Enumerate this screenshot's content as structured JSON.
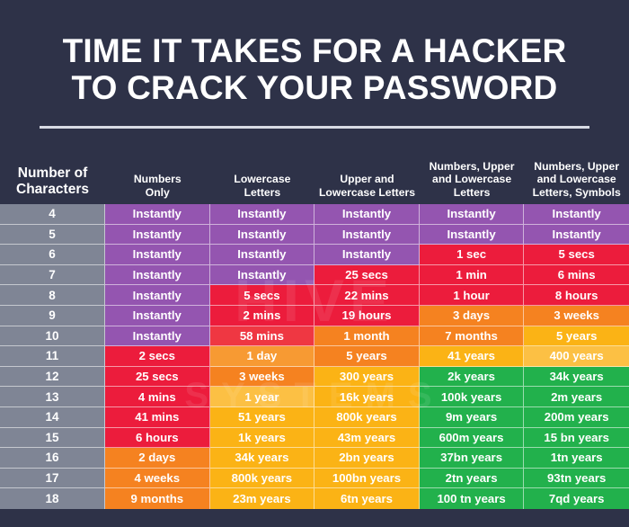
{
  "title": {
    "line1": "TIME IT TAKES FOR A HACKER",
    "line2": "TO CRACK YOUR PASSWORD"
  },
  "watermark": {
    "top": "HIVE",
    "bottom": "SYSTEMS"
  },
  "theme": {
    "background": "#2e3248",
    "divider": "#d8dbe4",
    "label_column": "#7f8595",
    "purple": "#9455b0",
    "red": "#ec1c3c",
    "red_light": "#ef3742",
    "orange": "#f58220",
    "orange_light": "#f79a33",
    "amber": "#fbb315",
    "amber_light": "#fcc044",
    "green": "#22b14c"
  },
  "table": {
    "headers": [
      "Number of Characters",
      "Numbers Only",
      "Lowercase Letters",
      "Upper and Lowercase Letters",
      "Numbers, Upper and Lowercase Letters",
      "Numbers, Upper and Lowercase Letters, Symbols"
    ],
    "header_lines": [
      [
        "Number of",
        "Characters"
      ],
      [
        "Numbers",
        "Only"
      ],
      [
        "Lowercase",
        "Letters"
      ],
      [
        "Upper and",
        "Lowercase Letters"
      ],
      [
        "Numbers, Upper",
        "and Lowercase",
        "Letters"
      ],
      [
        "Numbers, Upper",
        "and Lowercase",
        "Letters, Symbols"
      ]
    ],
    "rows": [
      {
        "characters": "4",
        "cells": [
          {
            "text": "Instantly",
            "color": "#9455b0"
          },
          {
            "text": "Instantly",
            "color": "#9455b0"
          },
          {
            "text": "Instantly",
            "color": "#9455b0"
          },
          {
            "text": "Instantly",
            "color": "#9455b0"
          },
          {
            "text": "Instantly",
            "color": "#9455b0"
          }
        ]
      },
      {
        "characters": "5",
        "cells": [
          {
            "text": "Instantly",
            "color": "#9455b0"
          },
          {
            "text": "Instantly",
            "color": "#9455b0"
          },
          {
            "text": "Instantly",
            "color": "#9455b0"
          },
          {
            "text": "Instantly",
            "color": "#9455b0"
          },
          {
            "text": "Instantly",
            "color": "#9455b0"
          }
        ]
      },
      {
        "characters": "6",
        "cells": [
          {
            "text": "Instantly",
            "color": "#9455b0"
          },
          {
            "text": "Instantly",
            "color": "#9455b0"
          },
          {
            "text": "Instantly",
            "color": "#9455b0"
          },
          {
            "text": "1 sec",
            "color": "#ec1c3c"
          },
          {
            "text": "5 secs",
            "color": "#ec1c3c"
          }
        ]
      },
      {
        "characters": "7",
        "cells": [
          {
            "text": "Instantly",
            "color": "#9455b0"
          },
          {
            "text": "Instantly",
            "color": "#9455b0"
          },
          {
            "text": "25 secs",
            "color": "#ec1c3c"
          },
          {
            "text": "1 min",
            "color": "#ec1c3c"
          },
          {
            "text": "6 mins",
            "color": "#ec1c3c"
          }
        ]
      },
      {
        "characters": "8",
        "cells": [
          {
            "text": "Instantly",
            "color": "#9455b0"
          },
          {
            "text": "5 secs",
            "color": "#ec1c3c"
          },
          {
            "text": "22 mins",
            "color": "#ec1c3c"
          },
          {
            "text": "1 hour",
            "color": "#ec1c3c"
          },
          {
            "text": "8 hours",
            "color": "#ec1c3c"
          }
        ]
      },
      {
        "characters": "9",
        "cells": [
          {
            "text": "Instantly",
            "color": "#9455b0"
          },
          {
            "text": "2 mins",
            "color": "#ec1c3c"
          },
          {
            "text": "19 hours",
            "color": "#ec1c3c"
          },
          {
            "text": "3 days",
            "color": "#f58220"
          },
          {
            "text": "3 weeks",
            "color": "#f58220"
          }
        ]
      },
      {
        "characters": "10",
        "cells": [
          {
            "text": "Instantly",
            "color": "#9455b0"
          },
          {
            "text": "58 mins",
            "color": "#ef3742"
          },
          {
            "text": "1 month",
            "color": "#f58220"
          },
          {
            "text": "7 months",
            "color": "#f58220"
          },
          {
            "text": "5 years",
            "color": "#fbb315"
          }
        ]
      },
      {
        "characters": "11",
        "cells": [
          {
            "text": "2 secs",
            "color": "#ec1c3c"
          },
          {
            "text": "1 day",
            "color": "#f79a33"
          },
          {
            "text": "5 years",
            "color": "#f58220"
          },
          {
            "text": "41 years",
            "color": "#fbb315"
          },
          {
            "text": "400 years",
            "color": "#fcc044"
          }
        ]
      },
      {
        "characters": "12",
        "cells": [
          {
            "text": "25 secs",
            "color": "#ec1c3c"
          },
          {
            "text": "3 weeks",
            "color": "#f58220"
          },
          {
            "text": "300 years",
            "color": "#fbb315"
          },
          {
            "text": "2k years",
            "color": "#22b14c"
          },
          {
            "text": "34k years",
            "color": "#22b14c"
          }
        ]
      },
      {
        "characters": "13",
        "cells": [
          {
            "text": "4 mins",
            "color": "#ec1c3c"
          },
          {
            "text": "1 year",
            "color": "#fcc044"
          },
          {
            "text": "16k years",
            "color": "#fbb315"
          },
          {
            "text": "100k years",
            "color": "#22b14c"
          },
          {
            "text": "2m years",
            "color": "#22b14c"
          }
        ]
      },
      {
        "characters": "14",
        "cells": [
          {
            "text": "41 mins",
            "color": "#ec1c3c"
          },
          {
            "text": "51 years",
            "color": "#fbb315"
          },
          {
            "text": "800k years",
            "color": "#fbb315"
          },
          {
            "text": "9m years",
            "color": "#22b14c"
          },
          {
            "text": "200m years",
            "color": "#22b14c"
          }
        ]
      },
      {
        "characters": "15",
        "cells": [
          {
            "text": "6 hours",
            "color": "#ec1c3c"
          },
          {
            "text": "1k years",
            "color": "#fbb315"
          },
          {
            "text": "43m years",
            "color": "#fbb315"
          },
          {
            "text": "600m years",
            "color": "#22b14c"
          },
          {
            "text": "15 bn years",
            "color": "#22b14c"
          }
        ]
      },
      {
        "characters": "16",
        "cells": [
          {
            "text": "2 days",
            "color": "#f58220"
          },
          {
            "text": "34k years",
            "color": "#fbb315"
          },
          {
            "text": "2bn years",
            "color": "#fbb315"
          },
          {
            "text": "37bn years",
            "color": "#22b14c"
          },
          {
            "text": "1tn years",
            "color": "#22b14c"
          }
        ]
      },
      {
        "characters": "17",
        "cells": [
          {
            "text": "4 weeks",
            "color": "#f58220"
          },
          {
            "text": "800k years",
            "color": "#fbb315"
          },
          {
            "text": "100bn years",
            "color": "#fbb315"
          },
          {
            "text": "2tn years",
            "color": "#22b14c"
          },
          {
            "text": "93tn years",
            "color": "#22b14c"
          }
        ]
      },
      {
        "characters": "18",
        "cells": [
          {
            "text": "9 months",
            "color": "#f58220"
          },
          {
            "text": "23m years",
            "color": "#fbb315"
          },
          {
            "text": "6tn years",
            "color": "#fbb315"
          },
          {
            "text": "100 tn years",
            "color": "#22b14c"
          },
          {
            "text": "7qd years",
            "color": "#22b14c"
          }
        ]
      }
    ]
  }
}
